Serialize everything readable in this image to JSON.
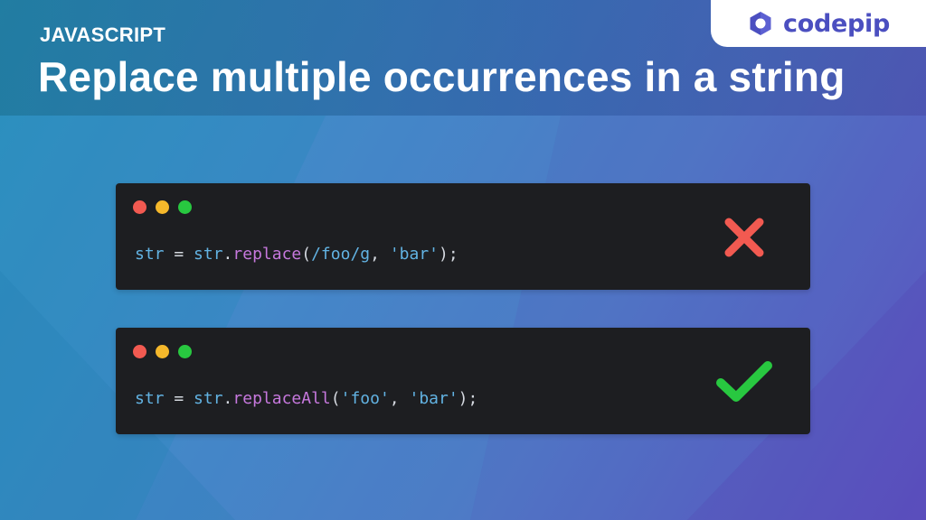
{
  "header": {
    "category": "JAVASCRIPT",
    "title": "Replace multiple occurrences in a string"
  },
  "brand": {
    "name": "codepip",
    "color": "#4b4fc0",
    "icon": "codepip-logo-icon"
  },
  "snippets": [
    {
      "status": "incorrect",
      "status_icon": "cross-icon",
      "status_color": "#f25a51",
      "code": {
        "lhs": "str",
        "eq": " = ",
        "obj": "str",
        "dot": ".",
        "method": "replace",
        "open": "(",
        "arg1": "/foo/g",
        "sep": ", ",
        "arg2": "'bar'",
        "close": ");"
      }
    },
    {
      "status": "correct",
      "status_icon": "checkmark-icon",
      "status_color": "#28c840",
      "code": {
        "lhs": "str",
        "eq": " = ",
        "obj": "str",
        "dot": ".",
        "method": "replaceAll",
        "open": "(",
        "arg1": "'foo'",
        "sep": ", ",
        "arg2": "'bar'",
        "close": ");"
      }
    }
  ],
  "window_controls": [
    "close-dot",
    "minimize-dot",
    "maximize-dot"
  ]
}
